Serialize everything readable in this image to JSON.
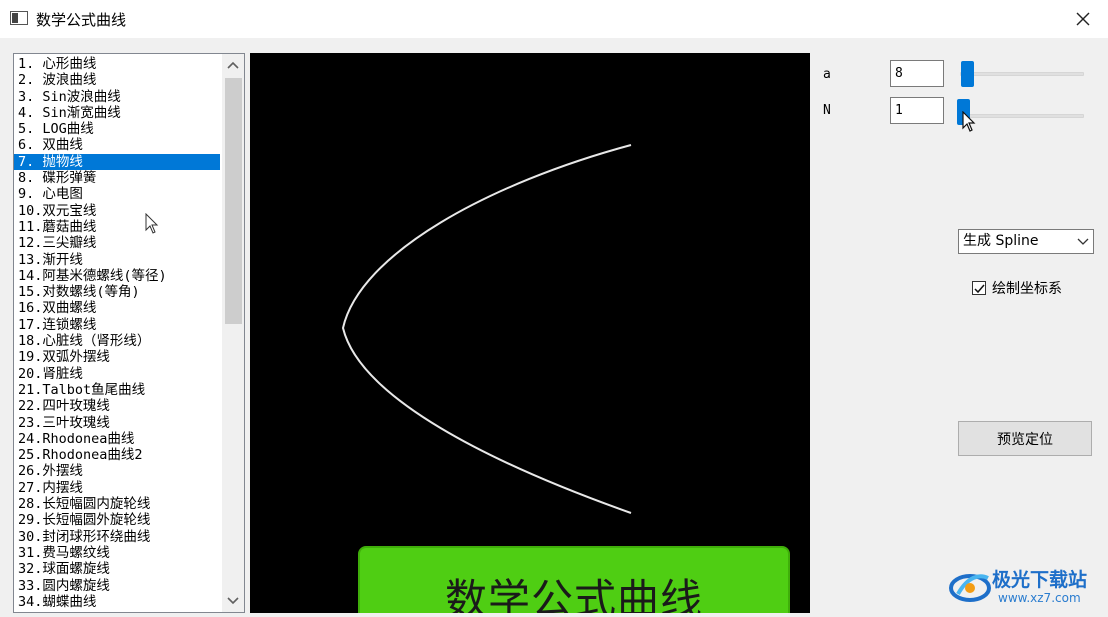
{
  "window": {
    "title": "数学公式曲线"
  },
  "curve_list": {
    "selected_index": 6,
    "items": [
      "1.  心形曲线",
      "2.  波浪曲线",
      "3.  Sin波浪曲线",
      "4.  Sin渐宽曲线",
      "5.  LOG曲线",
      "6.  双曲线",
      "7.  抛物线",
      "8.  碟形弹簧",
      "9.  心电图",
      "10.双元宝线",
      "11.蘑菇曲线",
      "12.三尖瓣线",
      "13.渐开线",
      "14.阿基米德螺线(等径)",
      "15.对数螺线(等角)",
      "16.双曲螺线",
      "17.连锁螺线",
      "18.心脏线（肾形线）",
      "19.双弧外摆线",
      "20.肾脏线",
      "21.Talbot鱼尾曲线",
      "22.四叶玫瑰线",
      "23.三叶玫瑰线",
      "24.Rhodonea曲线",
      "25.Rhodonea曲线2",
      "26.外摆线",
      "27.内摆线",
      "28.长短幅圆内旋轮线",
      "29.长短幅圆外旋轮线",
      "30.封闭球形环绕曲线",
      "31.费马螺纹线",
      "32.球面螺旋线",
      "33.圆内螺旋线",
      "34.蝴蝶曲线"
    ]
  },
  "canvas": {
    "banner_text": "数学公式曲线",
    "curve_color": "#e8e8e8",
    "banner_color": "#4fce13"
  },
  "params": {
    "a": {
      "label": "a",
      "value": "8",
      "slider_fraction": 0.04
    },
    "n": {
      "label": "N",
      "value": "1",
      "slider_fraction": 0.0
    }
  },
  "mode_select": {
    "value": "生成 Spline"
  },
  "axes_checkbox": {
    "label": "绘制坐标系",
    "checked": true
  },
  "preview_button": {
    "label": "预览定位"
  },
  "watermark": {
    "main": "极光下载站",
    "sub": "www.xz7.com"
  },
  "colors": {
    "selection": "#0078d7",
    "slider_thumb": "#0078d7",
    "watermark": "#1e6fc9"
  }
}
